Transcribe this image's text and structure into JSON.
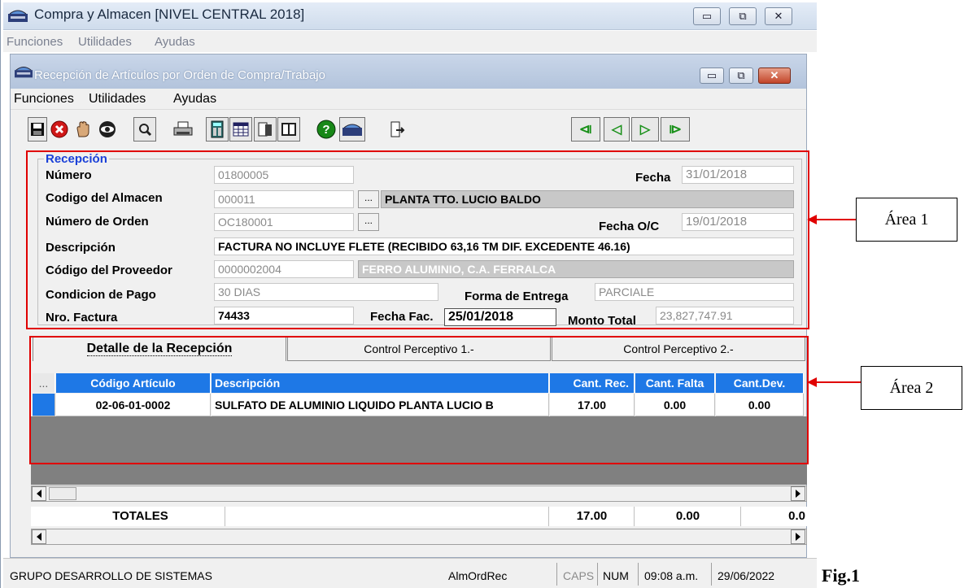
{
  "outer_window": {
    "title": "Compra y Almacen [NIVEL CENTRAL 2018]",
    "menu": [
      "Funciones",
      "Utilidades",
      "Ayudas"
    ],
    "controls": {
      "minimize": "▭",
      "restore": "⧉",
      "close": "✕"
    }
  },
  "inner_window": {
    "title": "Recepción de Artículos por Orden de Compra/Trabajo",
    "menu": [
      "Funciones",
      "Utilidades",
      "Ayudas"
    ],
    "controls": {
      "minimize": "▭",
      "restore": "⧉",
      "close": "✕"
    }
  },
  "toolbar": {
    "nav": {
      "first": "⧏",
      "prev": "◁",
      "next": "▷",
      "last": "⧐"
    }
  },
  "recepcion": {
    "legend": "Recepción",
    "numero_label": "Número",
    "numero_value": "01800005",
    "fecha_label": "Fecha",
    "fecha_value": "31/01/2018",
    "almacen_label": "Codigo del Almacen",
    "almacen_code": "000011",
    "almacen_name": "PLANTA TTO. LUCIO BALDO",
    "orden_label": "Número de Orden",
    "orden_value": "OC180001",
    "fecha_oc_label": "Fecha O/C",
    "fecha_oc_value": "19/01/2018",
    "descripcion_label": "Descripción",
    "descripcion_value": "FACTURA NO INCLUYE FLETE (RECIBIDO 63,16 TM DIF. EXCEDENTE 46.16)",
    "proveedor_label": "Código del  Proveedor",
    "proveedor_code": "0000002004",
    "proveedor_name": "FERRO ALUMINIO, C.A. FERRALCA",
    "pago_label": "Condicion de Pago",
    "pago_value": "30 DIAS",
    "entrega_label": "Forma de Entrega",
    "entrega_value": "PARCIALE",
    "factura_label": "Nro. Factura",
    "factura_value": "74433",
    "fecha_fac_label": "Fecha Fac.",
    "fecha_fac_value": "25/01/2018",
    "monto_label": "Monto Total",
    "monto_value": "23,827,747.91",
    "ellipsis": "..."
  },
  "tabs": [
    "Detalle de la Recepción",
    "Control Perceptivo 1.-",
    "Control Perceptivo 2.-"
  ],
  "grid": {
    "corner": "...",
    "columns": [
      "Código  Artículo",
      "Descripción",
      "Cant. Rec.",
      "Cant. Falta",
      "Cant.Dev."
    ],
    "rows": [
      [
        "02-06-01-0002",
        "SULFATO DE ALUMINIO LIQUIDO PLANTA LUCIO B",
        "17.00",
        "0.00",
        "0.00"
      ]
    ],
    "totals_label": "TOTALES",
    "totals": [
      "17.00",
      "0.00",
      "0.0"
    ]
  },
  "status_bar": {
    "group": "GRUPO DESARROLLO DE SISTEMAS",
    "form": "AlmOrdRec",
    "caps": "CAPS",
    "num": "NUM",
    "time": "09:08 a.m.",
    "date": "29/06/2022"
  },
  "annotations": {
    "area1": "Área 1",
    "area2": "Área 2",
    "figure": "Fig.1"
  },
  "colors": {
    "grid_header": "#1e78e6",
    "highlight_border": "#e00000",
    "legend_text": "#1a40d8"
  }
}
